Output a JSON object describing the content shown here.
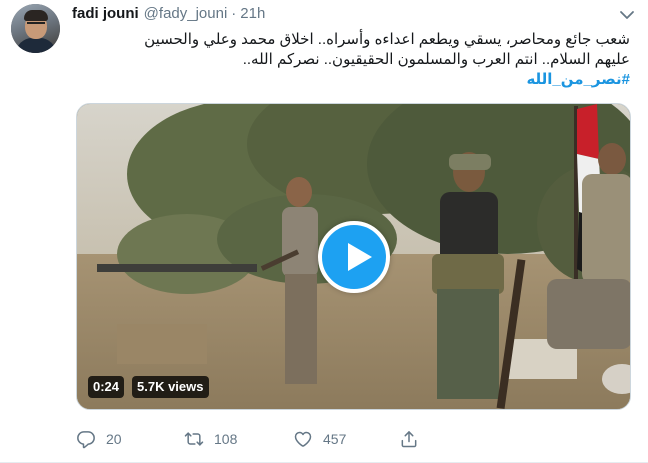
{
  "tweet": {
    "author": {
      "display_name": "fadi jouni",
      "handle": "@fady_jouni",
      "separator": "·",
      "time": "21h"
    },
    "text_lines": [
      "شعب جائع ومحاصر، يسقي ويطعم اعداءه وأسراه.. اخلاق محمد وعلي والحسين",
      "عليهم السلام.. انتم العرب والمسلمون الحقيقيون.. نصركم الله..",
      "#نصر_من_الله"
    ],
    "media": {
      "duration": "0:24",
      "views": "5.7K views"
    },
    "actions": {
      "reply_count": "20",
      "retweet_count": "108",
      "like_count": "457"
    },
    "colors": {
      "link": "#1b95e0",
      "play_button": "#1da1f2",
      "secondary_text": "#657786"
    },
    "icons": [
      "chevron-down-icon",
      "play-icon",
      "reply-icon",
      "retweet-icon",
      "like-icon",
      "share-icon"
    ]
  }
}
